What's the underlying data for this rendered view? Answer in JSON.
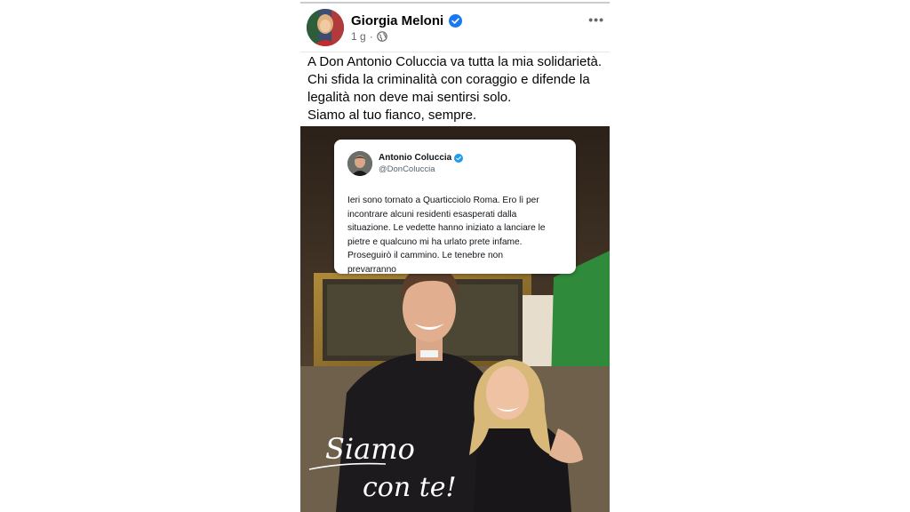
{
  "post": {
    "author": "Giorgia Meloni",
    "time": "1 g",
    "verified_icon": "verified-badge-icon",
    "privacy_icon": "globe-icon",
    "more_label": "•••",
    "caption_lines": [
      "A Don Antonio Coluccia va tutta la mia solidarietà.",
      "Chi sfida la criminalità con coraggio e difende la",
      "legalità non deve mai sentirsi solo.",
      "Siamo al tuo fianco, sempre."
    ]
  },
  "tweet": {
    "name": "Antonio Coluccia",
    "handle": "@DonColuccia",
    "text_lines": [
      "Ieri sono tornato a Quarticciolo Roma. Ero lì per",
      "incontrare alcuni residenti esasperati dalla",
      "situazione. Le vedette hanno iniziato a lanciare le",
      "pietre e qualcuno mi ha urlato prete infame.",
      "Proseguirò il cammino. Le tenebre non",
      "prevarranno"
    ]
  },
  "image": {
    "signature_line1": "Siamo",
    "signature_line2": "con te!"
  },
  "colors": {
    "verified_blue": "#1877f2",
    "twitter_blue": "#1d9bf0",
    "meta_gray": "#65676b"
  }
}
